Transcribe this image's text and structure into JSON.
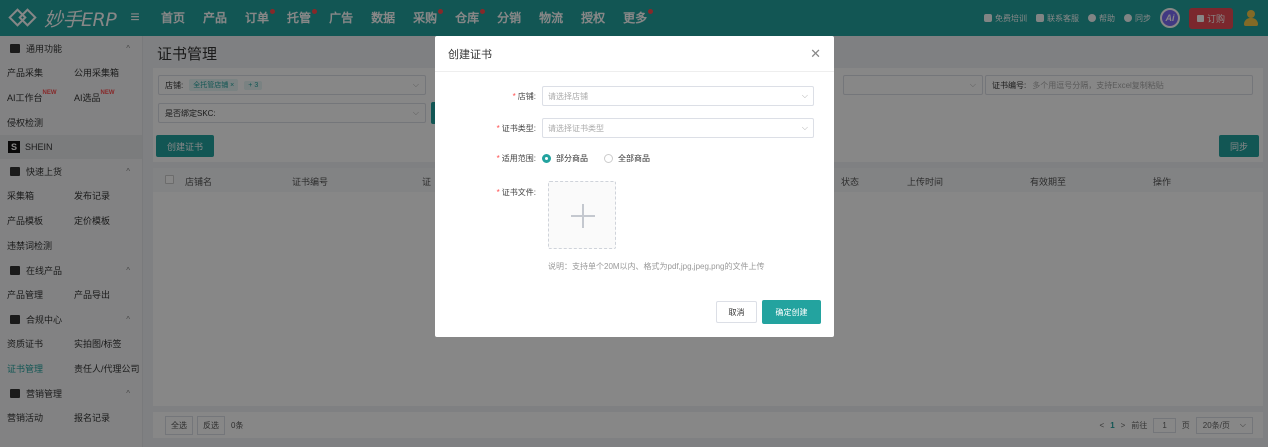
{
  "brand": {
    "logo_text": "妙手ERP",
    "accent": "#23a39f"
  },
  "nav": {
    "menu_icon": "hamburger-icon",
    "items": [
      {
        "label": "首页",
        "dot": false
      },
      {
        "label": "产品",
        "dot": false
      },
      {
        "label": "订单",
        "dot": true
      },
      {
        "label": "托管",
        "dot": true
      },
      {
        "label": "广告",
        "dot": false
      },
      {
        "label": "数据",
        "dot": false
      },
      {
        "label": "采购",
        "dot": true
      },
      {
        "label": "仓库",
        "dot": true
      },
      {
        "label": "分销",
        "dot": false
      },
      {
        "label": "物流",
        "dot": false
      },
      {
        "label": "授权",
        "dot": false
      },
      {
        "label": "更多",
        "dot": true
      }
    ]
  },
  "top_right": {
    "training": "免费培训",
    "support": "联系客服",
    "help": "帮助",
    "sync": "同步",
    "ai": "Ai",
    "order": "订购"
  },
  "sidebar": {
    "groups": [
      {
        "title": "通用功能",
        "rows": [
          [
            "产品采集",
            "公用采集箱"
          ],
          [
            "AI工作台",
            "AI选品"
          ],
          [
            "侵权检测"
          ]
        ]
      },
      {
        "title": "SHEIN"
      },
      {
        "title": "快速上货",
        "rows": [
          [
            "采集箱",
            "发布记录"
          ],
          [
            "产品模板",
            "定价模板"
          ],
          [
            "违禁词检测"
          ]
        ]
      },
      {
        "title": "在线产品",
        "rows": [
          [
            "产品管理",
            "产品导出"
          ]
        ]
      },
      {
        "title": "合规中心",
        "rows": [
          [
            "资质证书",
            "实拍图/标签"
          ],
          [
            "证书管理",
            "责任人/代理公司"
          ]
        ]
      },
      {
        "title": "营销管理",
        "rows": [
          [
            "营销活动",
            "报名记录"
          ]
        ]
      }
    ],
    "new_badge": "NEW"
  },
  "main": {
    "title": "证书管理",
    "filters": {
      "store_label": "店铺:",
      "store_tag": "全托管店铺 ×",
      "store_more": "+ 3",
      "skc_label": "是否绑定SKC:",
      "cert_no_label": "证书编号:",
      "cert_no_placeholder": "多个用逗号分隔，支持Excel复制粘贴"
    },
    "create_button": "创建证书",
    "sync_button": "同步",
    "columns": [
      "店铺名",
      "证书编号",
      "证",
      "状态",
      "上传时间",
      "有效期至",
      "操作"
    ],
    "footer": {
      "select_all": "全选",
      "invert": "反选",
      "count": "0条",
      "page": "1",
      "goto": "前往",
      "page_input": "1",
      "page_unit": "页",
      "page_size": "20条/页"
    }
  },
  "modal": {
    "title": "创建证书",
    "store_label": "店铺:",
    "store_placeholder": "请选择店铺",
    "type_label": "证书类型:",
    "type_placeholder": "请选择证书类型",
    "scope_label": "适用范围:",
    "scope_options": [
      "部分商品",
      "全部商品"
    ],
    "scope_selected": 0,
    "file_label": "证书文件:",
    "upload_note": "说明：支持单个20M以内、格式为pdf,jpg,jpeg,png的文件上传",
    "cancel": "取消",
    "confirm": "确定创建"
  }
}
